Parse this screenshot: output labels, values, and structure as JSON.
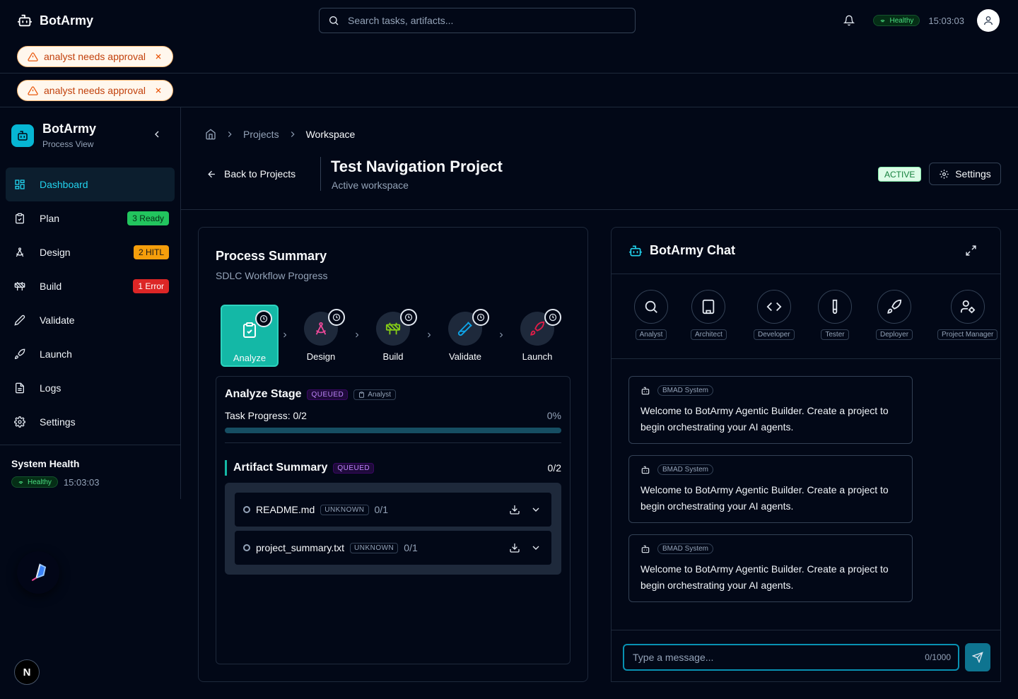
{
  "header": {
    "brand": "BotArmy",
    "search_placeholder": "Search tasks, artifacts...",
    "health": "Healthy",
    "time": "15:03:03"
  },
  "toasts": [
    "analyst needs approval",
    "analyst needs approval"
  ],
  "sidebar": {
    "title": "BotArmy",
    "subtitle": "Process View",
    "items": [
      {
        "label": "Dashboard",
        "icon": "dashboard-icon"
      },
      {
        "label": "Plan",
        "icon": "clipboard-icon",
        "badge": "3 Ready",
        "badge_color": "#22c55e"
      },
      {
        "label": "Design",
        "icon": "compass-icon",
        "badge": "2 HITL",
        "badge_color": "#f59e0b"
      },
      {
        "label": "Build",
        "icon": "construction-icon",
        "badge": "1 Error",
        "badge_color": "#dc2626"
      },
      {
        "label": "Validate",
        "icon": "pen-icon"
      },
      {
        "label": "Launch",
        "icon": "rocket-icon"
      },
      {
        "label": "Logs",
        "icon": "file-icon"
      },
      {
        "label": "Settings",
        "icon": "gear-icon"
      }
    ],
    "footer_title": "System Health",
    "footer_health": "Healthy",
    "footer_time": "15:03:03"
  },
  "breadcrumb": {
    "items": [
      "Projects",
      "Workspace"
    ]
  },
  "project": {
    "back_label": "Back to Projects",
    "title": "Test Navigation Project",
    "subtitle": "Active workspace",
    "status": "ACTIVE",
    "settings_label": "Settings"
  },
  "process": {
    "title": "Process Summary",
    "subtitle": "SDLC Workflow Progress",
    "stages": [
      "Analyze",
      "Design",
      "Build",
      "Validate",
      "Launch"
    ],
    "stage_title": "Analyze Stage",
    "stage_status": "QUEUED",
    "stage_agent": "Analyst",
    "task_progress_label": "Task Progress: 0/2",
    "task_progress_pct": "0%",
    "progress_value": 0,
    "artifact_title": "Artifact Summary",
    "artifact_status": "QUEUED",
    "artifact_count": "0/2",
    "artifacts": [
      {
        "name": "README.md",
        "status": "UNKNOWN",
        "count": "0/1"
      },
      {
        "name": "project_summary.txt",
        "status": "UNKNOWN",
        "count": "0/1"
      }
    ]
  },
  "chat": {
    "title": "BotArmy Chat",
    "agents": [
      "Analyst",
      "Architect",
      "Developer",
      "Tester",
      "Deployer",
      "Project Manager"
    ],
    "messages": [
      {
        "sender": "BMAD System",
        "text": "Welcome to BotArmy Agentic Builder. Create a project to begin orchestrating your AI agents."
      },
      {
        "sender": "BMAD System",
        "text": "Welcome to BotArmy Agentic Builder. Create a project to begin orchestrating your AI agents."
      },
      {
        "sender": "BMAD System",
        "text": "Welcome to BotArmy Agentic Builder. Create a project to begin orchestrating your AI agents."
      }
    ],
    "input_placeholder": "Type a message...",
    "char_count": "0/1000"
  },
  "misc": {
    "n_button": "N"
  }
}
